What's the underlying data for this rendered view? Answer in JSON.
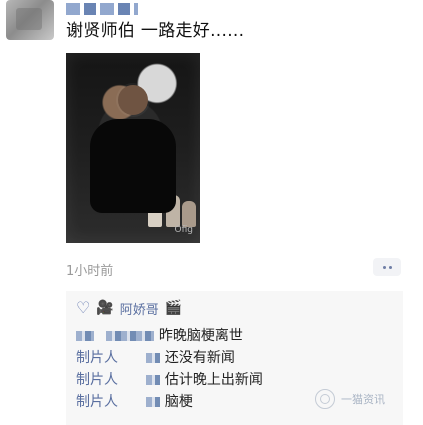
{
  "post": {
    "text": "谢贤师伯 一路走好......",
    "time": "1小时前",
    "photo_mark": "Ofig"
  },
  "likes": {
    "user": "阿娇哥"
  },
  "comments": [
    {
      "name": "制片人",
      "text": "昨晚脑梗离世"
    },
    {
      "name": "制片人",
      "text": "还没有新闻"
    },
    {
      "name": "制片人",
      "text": "估计晚上出新闻"
    },
    {
      "name": "制片人",
      "text": "脑梗"
    }
  ],
  "watermark": {
    "text": "一猫资讯"
  },
  "icons": [
    "heart-icon",
    "camera-icon",
    "more-dots-icon"
  ]
}
